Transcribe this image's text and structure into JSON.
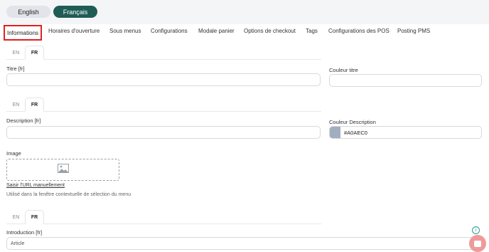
{
  "languages": {
    "english": "English",
    "french": "Français"
  },
  "tabs": [
    "Informations",
    "Horaires d'ouverture",
    "Sous menus",
    "Configurations",
    "Modale panier",
    "Options de checkout",
    "Tags",
    "Configurations des POS",
    "Posting PMS"
  ],
  "lang_tabs": {
    "en": "EN",
    "fr": "FR"
  },
  "form": {
    "title_label": "Titre [fr]",
    "title_value": "",
    "title_color_label": "Couleur titre",
    "title_color_value": "",
    "description_label": "Description [fr]",
    "description_value": "",
    "description_color_label": "Couleur Description",
    "description_color_value": "#A0AEC0",
    "image_label": "Image",
    "manual_url_link": "Saisir l'URL manuellement",
    "image_hint": "Utilisé dans la fenêtre contextuelle de sélection du menu",
    "introduction_label": "Introduction [fr]",
    "introduction_value": "Article"
  },
  "colors": {
    "accent": "#1f5c56",
    "active_tab_outline": "#e02020",
    "swatch": "#A0AEC0",
    "chat_button": "#ef9a9a"
  }
}
